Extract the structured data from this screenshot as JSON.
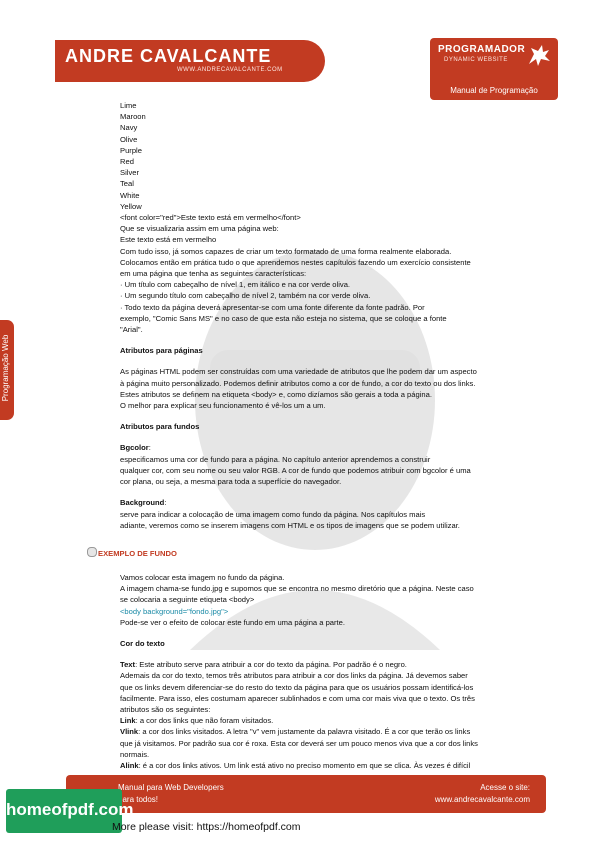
{
  "header": {
    "logo_text": "ANDRE CAVALCANTE",
    "logo_site": "WWW.ANDRECAVALCANTE.COM",
    "brand_title": "PROGRAMADOR",
    "brand_sub": "DYNAMIC WEBSITE",
    "manual_label": "Manual de Programação"
  },
  "side_tab": "Programação Web",
  "content": {
    "colors": [
      "Lime",
      "Maroon",
      "Navy",
      "Olive",
      "Purple",
      "Red",
      "Silver",
      "Teal",
      "White",
      "Yellow"
    ],
    "font_example": "<font color=\"red\">Este texto está em vermelho</font>",
    "view_intro": "Que se visualizaria assim em uma página web:",
    "view_result": "Este texto está em vermelho",
    "exercise_lines": [
      "Com tudo isso, já somos capazes de criar um texto formatado de uma forma realmente elaborada.",
      "Colocamos então em prática tudo o que aprendemos nestes capítulos fazendo um exercício consistente",
      "em uma página que tenha as seguintes características:",
      "· Um título com cabeçalho de nível 1, em itálico e na cor verde oliva.",
      "· Um segundo título com cabeçalho de nível 2, também na cor verde oliva.",
      "· Todo texto da página deverá apresentar-se com uma fonte diferente da fonte padrão. Por",
      "exemplo, \"Comic Sans MS\" e no caso de que esta não esteja no sistema, que se coloque a fonte",
      "\"Arial\"."
    ],
    "attr_pages_title": "Atributos para páginas",
    "attr_pages_lines": [
      "As páginas HTML podem ser construídas com uma variedade de atributos que lhe podem dar um aspecto",
      "à página muito personalizado. Podemos definir atributos como a cor de fundo, a cor do texto ou dos links.",
      "Estes atributos se definem na etiqueta <body> e, como dizíamos são gerais a toda a página.",
      "O melhor para explicar seu funcionamento é vê-los um a um."
    ],
    "attr_bg_title": "Atributos para fundos",
    "bgcolor_label": "Bgcolor",
    "bgcolor_colon": ":",
    "bgcolor_lines": [
      "especificamos uma cor de fundo para a página. No capítulo anterior aprendemos a construir",
      "qualquer cor, com seu nome ou seu valor RGB. A cor de fundo que podemos atribuir com bgcolor é uma",
      "cor plana, ou seja, a mesma para toda a superfície do navegador."
    ],
    "background_label": "Background",
    "background_colon": ":",
    "background_lines": [
      "serve para indicar a colocação de uma imagem como fundo da página. Nos capítulos mais",
      "adiante, veremos como se inserem imagens com HTML e os tipos de imagens que se podem utilizar."
    ],
    "example_heading": "EXEMPLO DE FUNDO",
    "example_lines": [
      "Vamos colocar esta imagem no fundo da página.",
      "A imagem chama-se fundo.jpg e supomos que se encontra no mesmo diretório que a página. Neste caso",
      "se colocaria a seguinte etiqueta <body>"
    ],
    "example_code": "<body background=\"fondo.jpg\">",
    "example_after": "Pode-se ver o efeito de colocar este fundo em uma página a parte.",
    "text_color_title": "Cor do texto",
    "text_label": "Text",
    "text_desc": ": Este atributo serve para atribuir a cor do texto da página. Por padrão é o negro.",
    "links_lines": [
      "Ademais da cor do texto, temos três atributos para atribuir a cor dos links da página. Já devemos saber",
      "que os links devem diferenciar-se do resto do texto da página para que os usuários possam identificá-los",
      "facilmente. Para isso, eles costumam aparecer sublinhados e com uma cor mais viva que o texto. Os três",
      "atributos são os seguintes:"
    ],
    "link_label": "Link",
    "link_desc": ": a cor dos links que não foram visitados.",
    "vlink_label": "Vlink",
    "vlink_lines": [
      ": a cor dos links visitados. A letra \"v\" vem justamente da palavra visitado. É a cor que terão os links",
      "que já visitamos. Por padrão sua cor é roxa. Esta cor deverá ser um pouco menos viva que a cor dos links",
      "normais."
    ],
    "alink_label": "Alink",
    "alink_desc": ": é a cor dos links ativos. Um link está ativo no preciso momento em que se clica. Às vezes é difícil"
  },
  "footer": {
    "left_line1": "Manual para Web Developers",
    "left_line2": "para todos!",
    "right_line1": "Acesse o site:",
    "right_line2": "www.andrecavalcante.com"
  },
  "overlay": {
    "badge": "homeofpdf.com",
    "visit_text": "More please visit: https://homeofpdf.com"
  },
  "colors": {
    "accent": "#c23b22",
    "code": "#1a8aa6",
    "badge": "#1f9e5a"
  }
}
